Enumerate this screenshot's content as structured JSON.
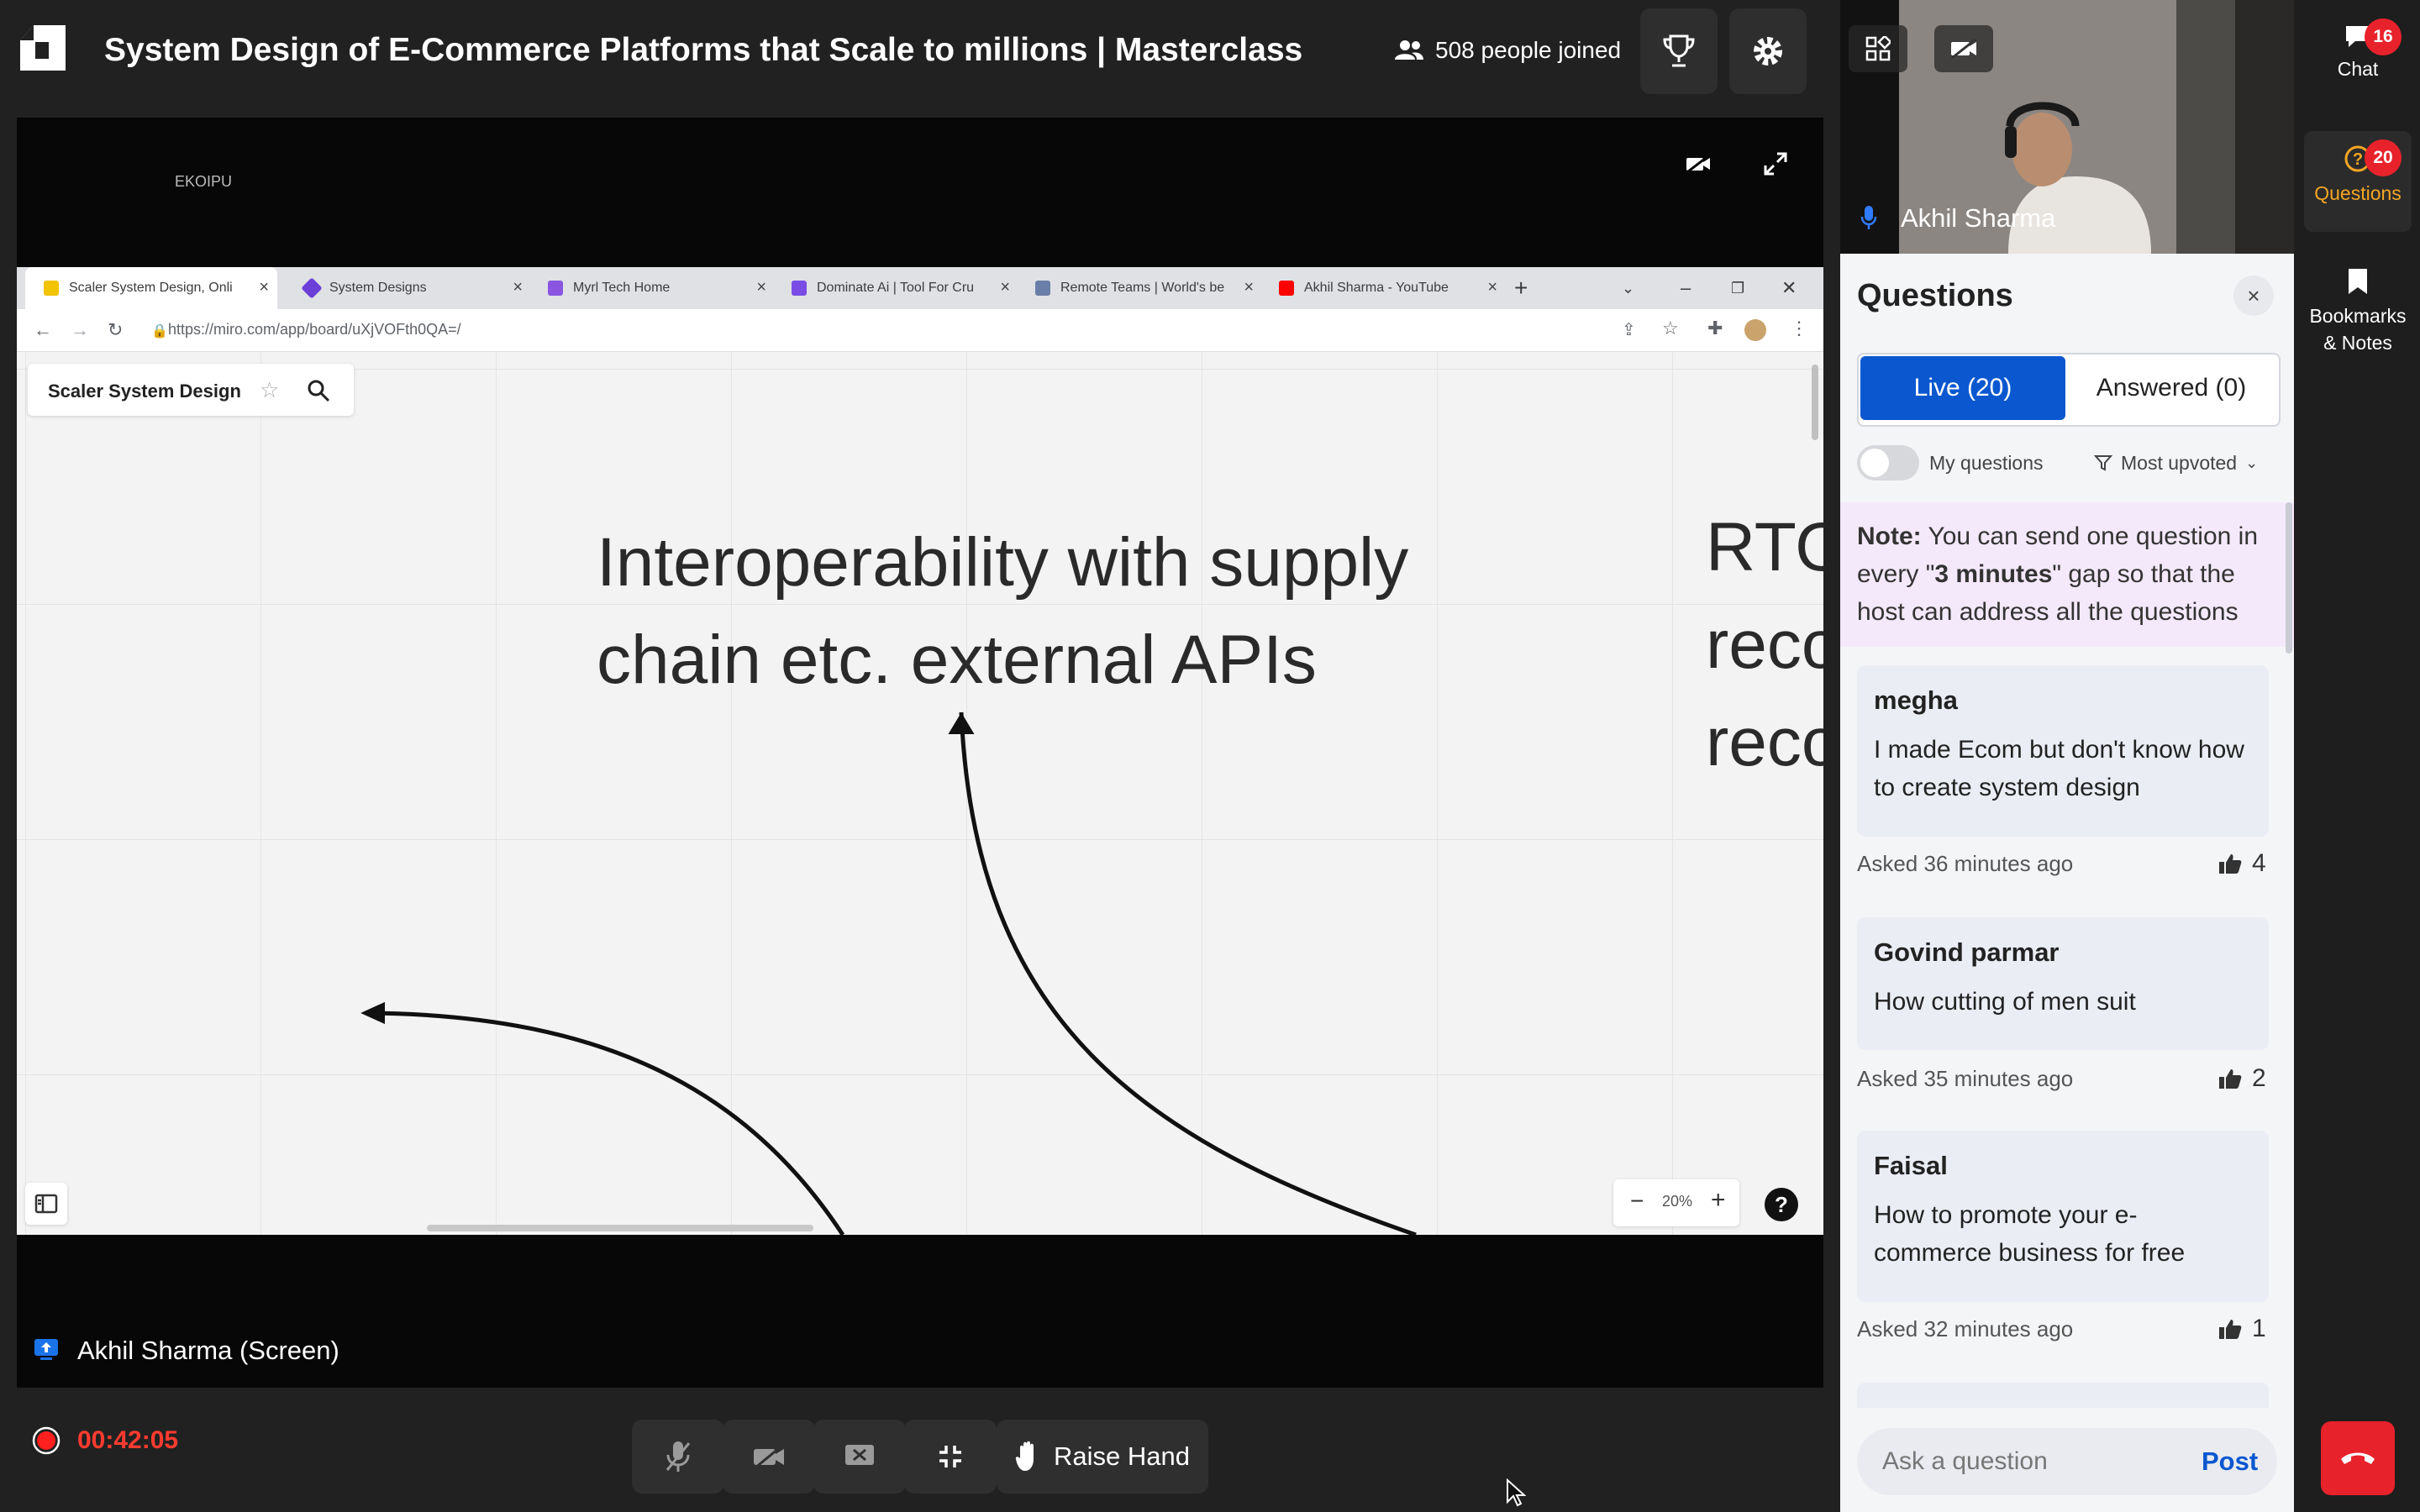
{
  "header": {
    "title": "System Design of E-Commerce Platforms that Scale to millions | Masterclass",
    "joined": "508 people joined"
  },
  "stage": {
    "watermark": "EKOIPU",
    "screen_label": "Akhil Sharma (Screen)"
  },
  "browser": {
    "tabs": [
      {
        "label": "Scaler System Design, Onli",
        "color": "#f2c300"
      },
      {
        "label": "System Designs",
        "color": "#6b3fd8"
      },
      {
        "label": "Myrl Tech Home",
        "color": "#8a55e0"
      },
      {
        "label": "Dominate Ai | Tool For Cru",
        "color": "#7a4de6"
      },
      {
        "label": "Remote Teams | World's be",
        "color": "#6a7fa8"
      },
      {
        "label": "Akhil Sharma - YouTube",
        "color": "#ff0000"
      }
    ],
    "url": "https://miro.com/app/board/uXjVOFth0QA=/"
  },
  "board": {
    "name": "Scaler System Design",
    "text_line1": "Interoperability with supply",
    "text_line2": "chain etc. external APIs",
    "right_line1": "RTO",
    "right_line2": "reco",
    "right_line3": "reco",
    "zoom": "20%"
  },
  "recording": {
    "time": "00:42:05"
  },
  "controls": {
    "raise_hand": "Raise Hand"
  },
  "video": {
    "presenter": "Akhil Sharma"
  },
  "questions": {
    "title": "Questions",
    "tab_live": "Live (20)",
    "tab_answered": "Answered (0)",
    "my_questions": "My questions",
    "sort": "Most upvoted",
    "note_label": "Note:",
    "note_before": " You can send one question in every \"",
    "note_bold": "3 minutes",
    "note_after": "\" gap so that the host can address all the questions",
    "items": [
      {
        "name": "megha",
        "text": "I made Ecom but don't know how to create system design",
        "asked": "Asked 36 minutes ago",
        "votes": "4"
      },
      {
        "name": "Govind parmar",
        "text": "How cutting of men suit",
        "asked": "Asked 35 minutes ago",
        "votes": "2"
      },
      {
        "name": "Faisal",
        "text": "How to promote your e-commerce business for free",
        "asked": "Asked 32 minutes ago",
        "votes": "1"
      }
    ],
    "ask_placeholder": "Ask a question",
    "post": "Post"
  },
  "rail": {
    "chat": "Chat",
    "chat_badge": "16",
    "questions": "Questions",
    "questions_badge": "20",
    "bookmarks_line1": "Bookmarks",
    "bookmarks_line2": "& Notes"
  },
  "colors": {
    "accent": "#0a57d0",
    "danger": "#e8222b",
    "active_rail": "#f5a623"
  }
}
